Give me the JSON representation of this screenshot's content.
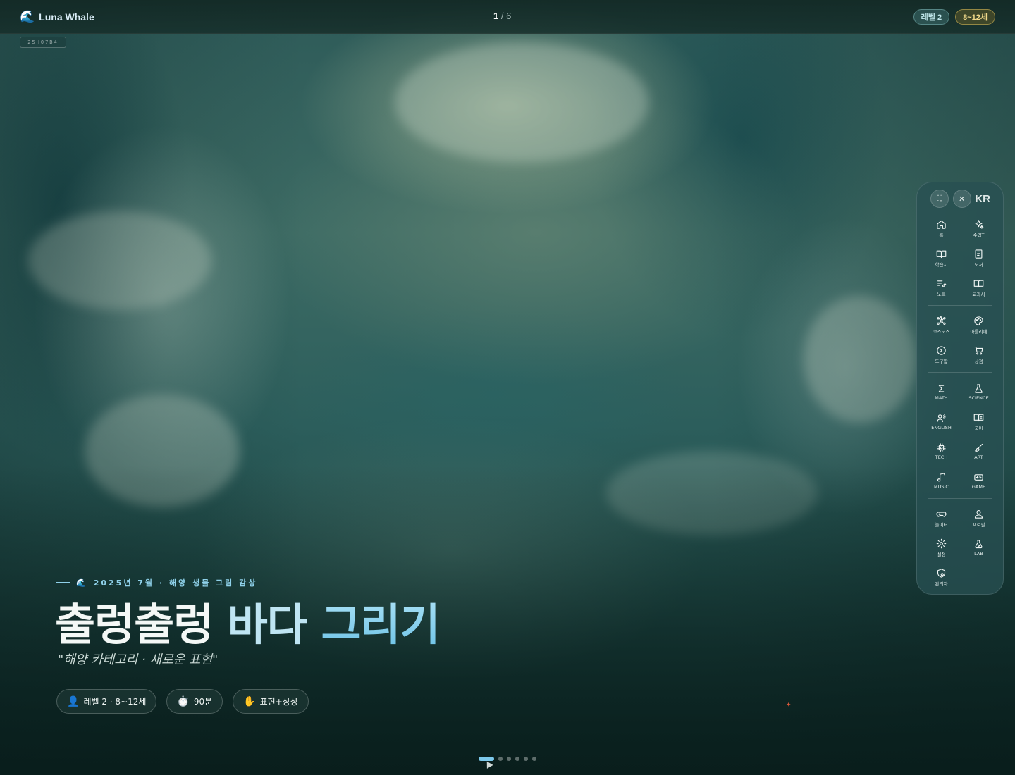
{
  "header": {
    "brand": "Luna Whale",
    "page_current": "1",
    "page_total": "/ 6",
    "level_badge": "레벨 2",
    "age_badge": "8~12세"
  },
  "slide_id": "25H07B4",
  "hero": {
    "kicker": "2025년 7월 · 해양 생물 그림 감상",
    "title_w1": "출렁출렁",
    "title_w2": "바다",
    "title_w3": "그리기",
    "subtitle": "\"해양 카테고리 · 새로운 표현\"",
    "chips": [
      {
        "icon": "👤",
        "label": "레벨 2 · 8~12세"
      },
      {
        "icon": "⏱️",
        "label": "90분"
      },
      {
        "icon": "✋",
        "label": "표현+상상"
      }
    ]
  },
  "pager": {
    "total": 6,
    "active": 0
  },
  "side_panel": {
    "lang": "KR",
    "group1": [
      {
        "name": "home",
        "label": "홈"
      },
      {
        "name": "class",
        "label": "수업T"
      },
      {
        "name": "worksheet",
        "label": "학습지"
      },
      {
        "name": "library",
        "label": "도서"
      },
      {
        "name": "note",
        "label": "노트"
      },
      {
        "name": "textbook",
        "label": "교과서"
      }
    ],
    "group2": [
      {
        "name": "cosmos",
        "label": "코스모스"
      },
      {
        "name": "atelier",
        "label": "아틀리에"
      },
      {
        "name": "tools",
        "label": "도구함"
      },
      {
        "name": "shop",
        "label": "상점"
      }
    ],
    "group3": [
      {
        "name": "math",
        "label": "MATH"
      },
      {
        "name": "science",
        "label": "SCIENCE"
      },
      {
        "name": "english",
        "label": "ENGLISH"
      },
      {
        "name": "korean",
        "label": "국어"
      },
      {
        "name": "tech",
        "label": "TECH"
      },
      {
        "name": "art",
        "label": "ART"
      },
      {
        "name": "music",
        "label": "MUSIC"
      },
      {
        "name": "game",
        "label": "GAME"
      }
    ],
    "group4": [
      {
        "name": "playground",
        "label": "놀이터"
      },
      {
        "name": "profile",
        "label": "프로필"
      },
      {
        "name": "settings",
        "label": "설정"
      },
      {
        "name": "lab",
        "label": "LAB"
      },
      {
        "name": "admin",
        "label": "관리자"
      }
    ]
  }
}
